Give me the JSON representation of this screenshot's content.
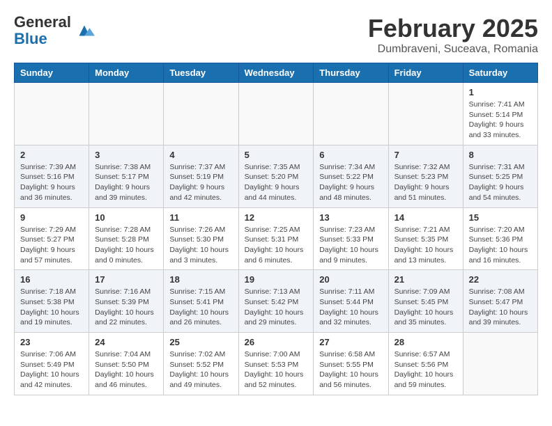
{
  "header": {
    "logo_general": "General",
    "logo_blue": "Blue",
    "month_title": "February 2025",
    "location": "Dumbraveni, Suceava, Romania"
  },
  "weekdays": [
    "Sunday",
    "Monday",
    "Tuesday",
    "Wednesday",
    "Thursday",
    "Friday",
    "Saturday"
  ],
  "weeks": [
    [
      {
        "day": "",
        "info": ""
      },
      {
        "day": "",
        "info": ""
      },
      {
        "day": "",
        "info": ""
      },
      {
        "day": "",
        "info": ""
      },
      {
        "day": "",
        "info": ""
      },
      {
        "day": "",
        "info": ""
      },
      {
        "day": "1",
        "info": "Sunrise: 7:41 AM\nSunset: 5:14 PM\nDaylight: 9 hours and 33 minutes."
      }
    ],
    [
      {
        "day": "2",
        "info": "Sunrise: 7:39 AM\nSunset: 5:16 PM\nDaylight: 9 hours and 36 minutes."
      },
      {
        "day": "3",
        "info": "Sunrise: 7:38 AM\nSunset: 5:17 PM\nDaylight: 9 hours and 39 minutes."
      },
      {
        "day": "4",
        "info": "Sunrise: 7:37 AM\nSunset: 5:19 PM\nDaylight: 9 hours and 42 minutes."
      },
      {
        "day": "5",
        "info": "Sunrise: 7:35 AM\nSunset: 5:20 PM\nDaylight: 9 hours and 44 minutes."
      },
      {
        "day": "6",
        "info": "Sunrise: 7:34 AM\nSunset: 5:22 PM\nDaylight: 9 hours and 48 minutes."
      },
      {
        "day": "7",
        "info": "Sunrise: 7:32 AM\nSunset: 5:23 PM\nDaylight: 9 hours and 51 minutes."
      },
      {
        "day": "8",
        "info": "Sunrise: 7:31 AM\nSunset: 5:25 PM\nDaylight: 9 hours and 54 minutes."
      }
    ],
    [
      {
        "day": "9",
        "info": "Sunrise: 7:29 AM\nSunset: 5:27 PM\nDaylight: 9 hours and 57 minutes."
      },
      {
        "day": "10",
        "info": "Sunrise: 7:28 AM\nSunset: 5:28 PM\nDaylight: 10 hours and 0 minutes."
      },
      {
        "day": "11",
        "info": "Sunrise: 7:26 AM\nSunset: 5:30 PM\nDaylight: 10 hours and 3 minutes."
      },
      {
        "day": "12",
        "info": "Sunrise: 7:25 AM\nSunset: 5:31 PM\nDaylight: 10 hours and 6 minutes."
      },
      {
        "day": "13",
        "info": "Sunrise: 7:23 AM\nSunset: 5:33 PM\nDaylight: 10 hours and 9 minutes."
      },
      {
        "day": "14",
        "info": "Sunrise: 7:21 AM\nSunset: 5:35 PM\nDaylight: 10 hours and 13 minutes."
      },
      {
        "day": "15",
        "info": "Sunrise: 7:20 AM\nSunset: 5:36 PM\nDaylight: 10 hours and 16 minutes."
      }
    ],
    [
      {
        "day": "16",
        "info": "Sunrise: 7:18 AM\nSunset: 5:38 PM\nDaylight: 10 hours and 19 minutes."
      },
      {
        "day": "17",
        "info": "Sunrise: 7:16 AM\nSunset: 5:39 PM\nDaylight: 10 hours and 22 minutes."
      },
      {
        "day": "18",
        "info": "Sunrise: 7:15 AM\nSunset: 5:41 PM\nDaylight: 10 hours and 26 minutes."
      },
      {
        "day": "19",
        "info": "Sunrise: 7:13 AM\nSunset: 5:42 PM\nDaylight: 10 hours and 29 minutes."
      },
      {
        "day": "20",
        "info": "Sunrise: 7:11 AM\nSunset: 5:44 PM\nDaylight: 10 hours and 32 minutes."
      },
      {
        "day": "21",
        "info": "Sunrise: 7:09 AM\nSunset: 5:45 PM\nDaylight: 10 hours and 35 minutes."
      },
      {
        "day": "22",
        "info": "Sunrise: 7:08 AM\nSunset: 5:47 PM\nDaylight: 10 hours and 39 minutes."
      }
    ],
    [
      {
        "day": "23",
        "info": "Sunrise: 7:06 AM\nSunset: 5:49 PM\nDaylight: 10 hours and 42 minutes."
      },
      {
        "day": "24",
        "info": "Sunrise: 7:04 AM\nSunset: 5:50 PM\nDaylight: 10 hours and 46 minutes."
      },
      {
        "day": "25",
        "info": "Sunrise: 7:02 AM\nSunset: 5:52 PM\nDaylight: 10 hours and 49 minutes."
      },
      {
        "day": "26",
        "info": "Sunrise: 7:00 AM\nSunset: 5:53 PM\nDaylight: 10 hours and 52 minutes."
      },
      {
        "day": "27",
        "info": "Sunrise: 6:58 AM\nSunset: 5:55 PM\nDaylight: 10 hours and 56 minutes."
      },
      {
        "day": "28",
        "info": "Sunrise: 6:57 AM\nSunset: 5:56 PM\nDaylight: 10 hours and 59 minutes."
      },
      {
        "day": "",
        "info": ""
      }
    ]
  ]
}
